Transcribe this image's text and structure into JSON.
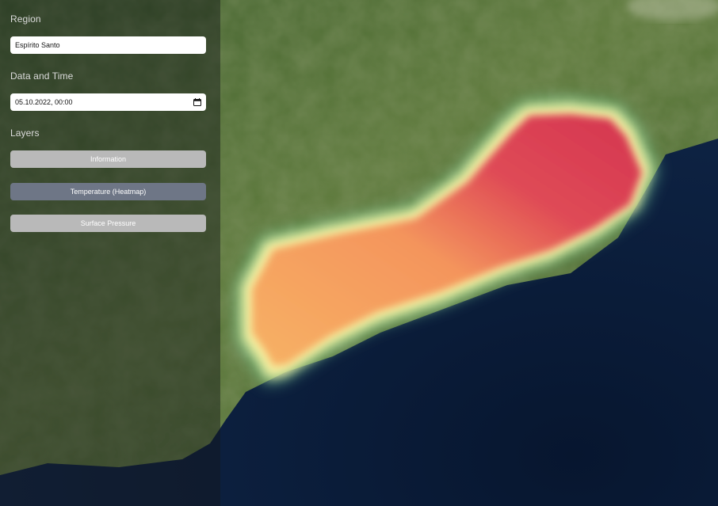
{
  "sidebar": {
    "region_label": "Region",
    "region_value": "Espírito Santo",
    "datetime_label": "Data and Time",
    "datetime_value": "05.10.2022, 00:00",
    "layers_label": "Layers",
    "layers": [
      {
        "label": "Information",
        "active": false
      },
      {
        "label": "Temperature (Heatmap)",
        "active": true
      },
      {
        "label": "Surface Pressure",
        "active": false
      }
    ]
  },
  "colors": {
    "inactive_button": "#b9b9b9",
    "active_button": "#6e7686",
    "heat_hot": "#d4344f",
    "heat_warm": "#f6a25a",
    "heat_edge": "#f5f0a0",
    "ocean": "#0b1a33"
  },
  "map": {
    "base_layer": "satellite imagery",
    "overlay": "temperature heatmap"
  }
}
